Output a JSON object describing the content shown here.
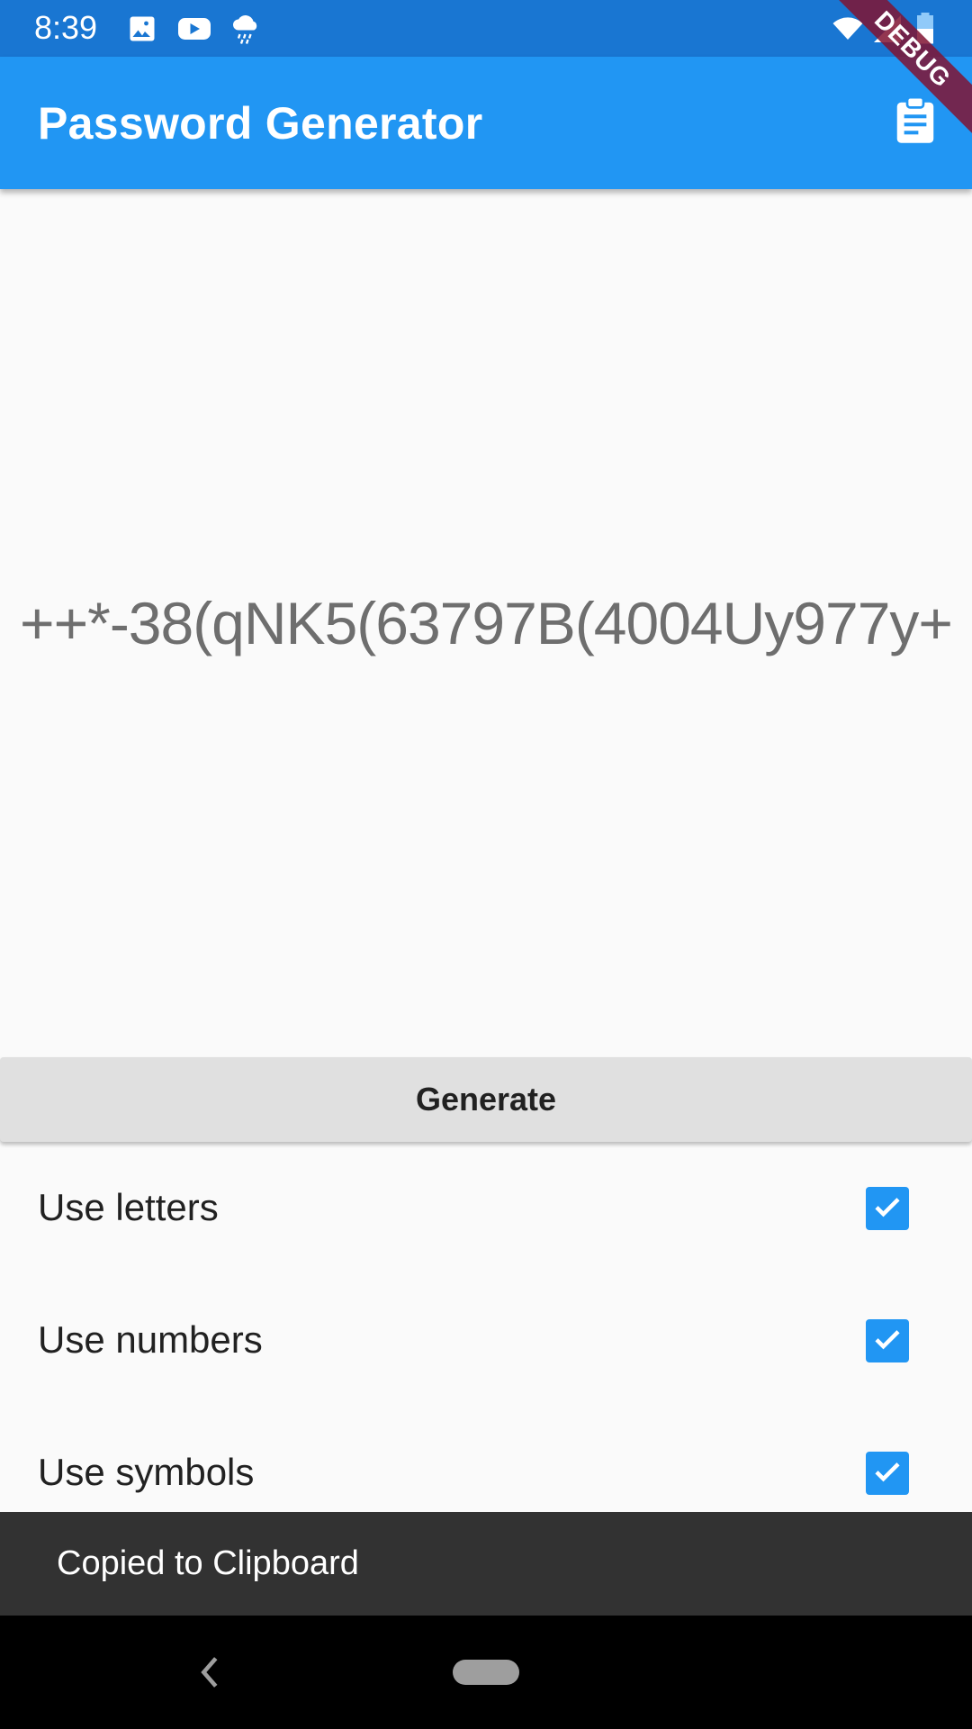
{
  "status_bar": {
    "time": "8:39",
    "left_icons": [
      "image-icon",
      "youtube-icon",
      "weather-rain-icon"
    ],
    "right_icons": [
      "wifi-icon",
      "signal-icon",
      "battery-icon"
    ],
    "color": "#1976d2"
  },
  "app_bar": {
    "title": "Password Generator",
    "action_icon": "clipboard-icon",
    "color": "#2196f3"
  },
  "debug_banner": {
    "label": "DEBUG"
  },
  "password": {
    "value": "++*-38(qNK5(63797B(4004Uy977y+"
  },
  "generate_button": {
    "label": "Generate"
  },
  "options": [
    {
      "label": "Use letters",
      "checked": true
    },
    {
      "label": "Use numbers",
      "checked": true
    },
    {
      "label": "Use symbols",
      "checked": true
    }
  ],
  "snackbar": {
    "message": "Copied to Clipboard"
  },
  "nav_bar": {
    "icons": [
      "back-icon",
      "home-icon"
    ]
  }
}
